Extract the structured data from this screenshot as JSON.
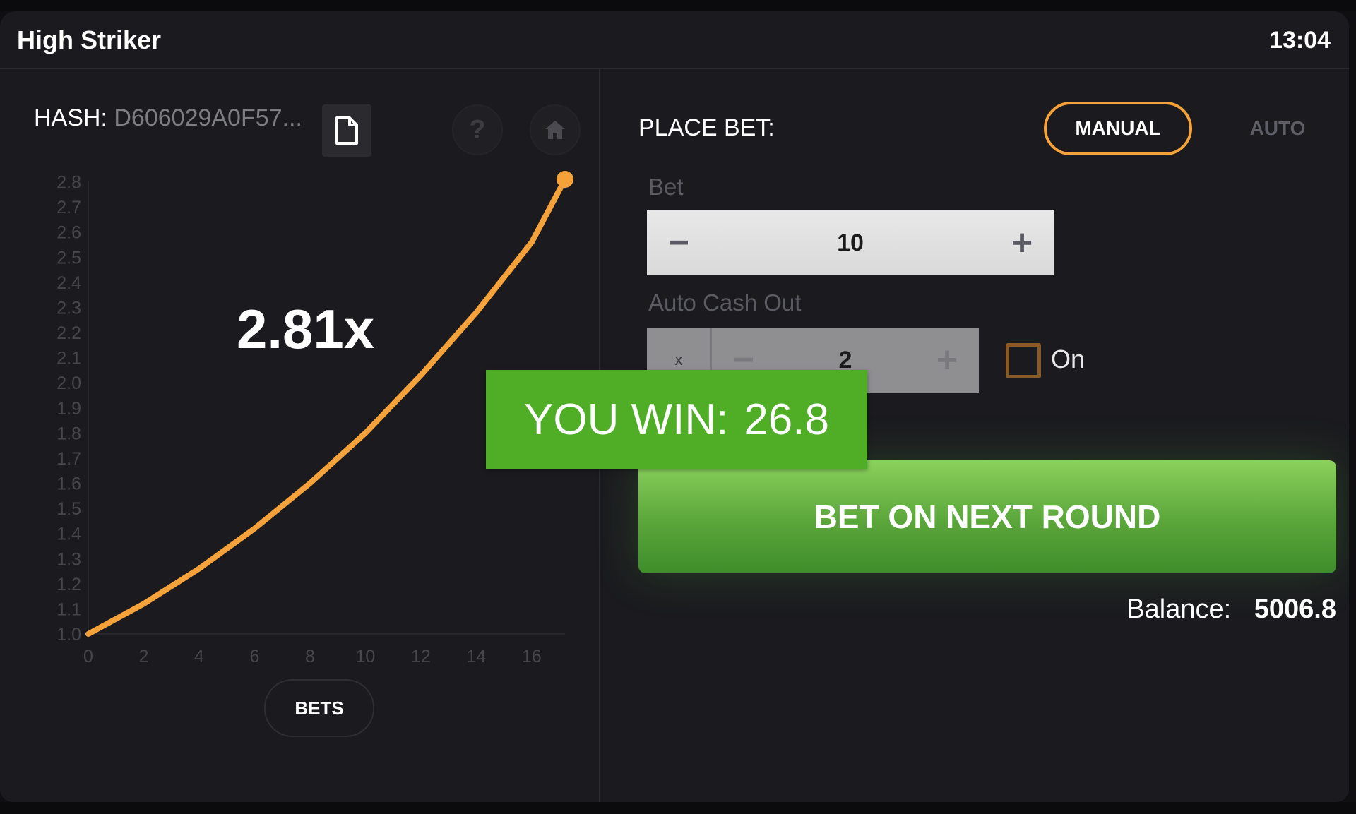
{
  "header": {
    "title": "High Striker",
    "time": "13:04"
  },
  "left": {
    "hash_label": "HASH:",
    "hash_value": "D606029A0F57...",
    "copy_icon": "document-icon",
    "help_label": "?",
    "home_icon": "home-icon",
    "multiplier": "2.81x",
    "bets_label": "BETS"
  },
  "chart_data": {
    "type": "line",
    "x": [
      0,
      2,
      4,
      6,
      8,
      10,
      12,
      14,
      16,
      17.2
    ],
    "y": [
      1.0,
      1.12,
      1.26,
      1.42,
      1.6,
      1.8,
      2.03,
      2.28,
      2.56,
      2.81
    ],
    "x_ticks": [
      "0",
      "2",
      "4",
      "6",
      "8",
      "10",
      "12",
      "14",
      "16"
    ],
    "y_ticks": [
      "1.0",
      "1.1",
      "1.2",
      "1.3",
      "1.4",
      "1.5",
      "1.6",
      "1.7",
      "1.8",
      "1.9",
      "2.0",
      "2.1",
      "2.2",
      "2.3",
      "2.4",
      "2.5",
      "2.6",
      "2.7",
      "2.8"
    ],
    "xlim": [
      0,
      17.2
    ],
    "ylim": [
      1.0,
      2.81
    ],
    "line_color": "#f5a23a",
    "grid": false
  },
  "right": {
    "place_bet_label": "PLACE BET:",
    "tab_manual": "MANUAL",
    "tab_auto": "AUTO",
    "bet_label": "Bet",
    "bet_value": "10",
    "minus": "−",
    "plus": "+",
    "auto_cash_label": "Auto Cash Out",
    "cash_prefix": "x",
    "cash_value": "2",
    "on_label": "On",
    "win_label": "YOU WIN:",
    "win_amount": "26.8",
    "bet_next_label": "BET ON NEXT ROUND",
    "balance_label": "Balance:",
    "balance_value": "5006.8"
  },
  "colors": {
    "accent": "#f5a23a",
    "win_green": "#4fae26",
    "button_green": "#6cbf45"
  }
}
